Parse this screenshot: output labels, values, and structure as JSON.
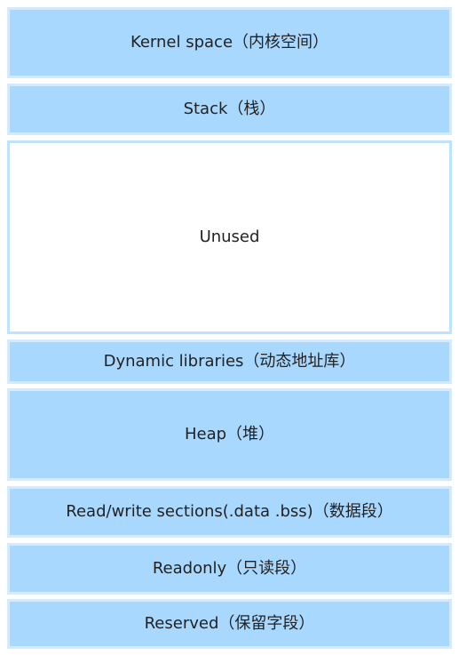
{
  "diagram": {
    "segments": [
      {
        "label": "Kernel space（内核空间）",
        "fill": "#a9d8ff"
      },
      {
        "label": "Stack（栈）",
        "fill": "#a9d8ff"
      },
      {
        "label": "Unused",
        "fill": "#ffffff"
      },
      {
        "label": "Dynamic libraries（动态地址库）",
        "fill": "#a9d8ff"
      },
      {
        "label": "Heap（堆）",
        "fill": "#a9d8ff"
      },
      {
        "label": "Read/write sections(.data .bss)（数据段）",
        "fill": "#a9d8ff"
      },
      {
        "label": "Readonly（只读段）",
        "fill": "#a9d8ff"
      },
      {
        "label": "Reserved（保留字段）",
        "fill": "#a9d8ff"
      }
    ]
  }
}
